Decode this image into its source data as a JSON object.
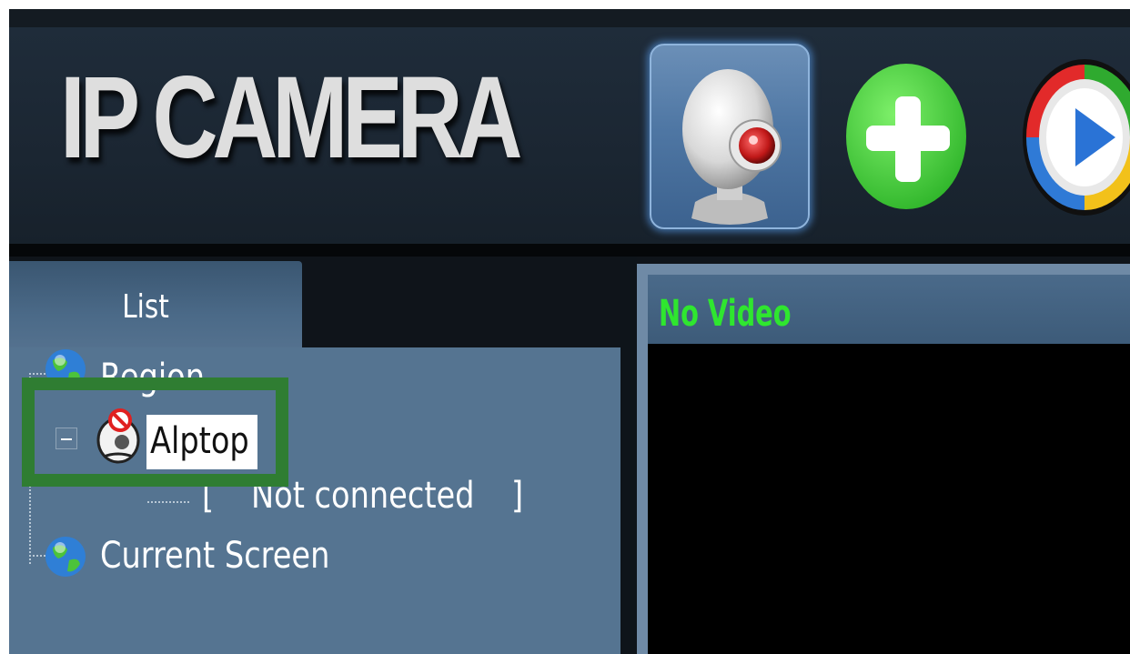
{
  "header": {
    "logo_text": "IP CAMERA",
    "toolbar": [
      {
        "name": "camera",
        "icon": "webcam-icon"
      },
      {
        "name": "add",
        "icon": "plus-icon"
      },
      {
        "name": "play",
        "icon": "play-icon"
      }
    ]
  },
  "sidebar": {
    "tab_label": "List",
    "tree": {
      "region": {
        "label": "Region",
        "icon": "globe-icon"
      },
      "device": {
        "label": "Alptop",
        "icon": "disconnected-camera-icon",
        "expanded": true
      },
      "device_status": {
        "open_bracket": "[",
        "label": "Not connected",
        "close_bracket": "]"
      },
      "current_screen": {
        "label": "Current Screen",
        "icon": "globe-icon"
      }
    }
  },
  "video": {
    "title": "No Video",
    "title_color": "#2fe62f"
  },
  "highlight_color": "#2f7d32"
}
